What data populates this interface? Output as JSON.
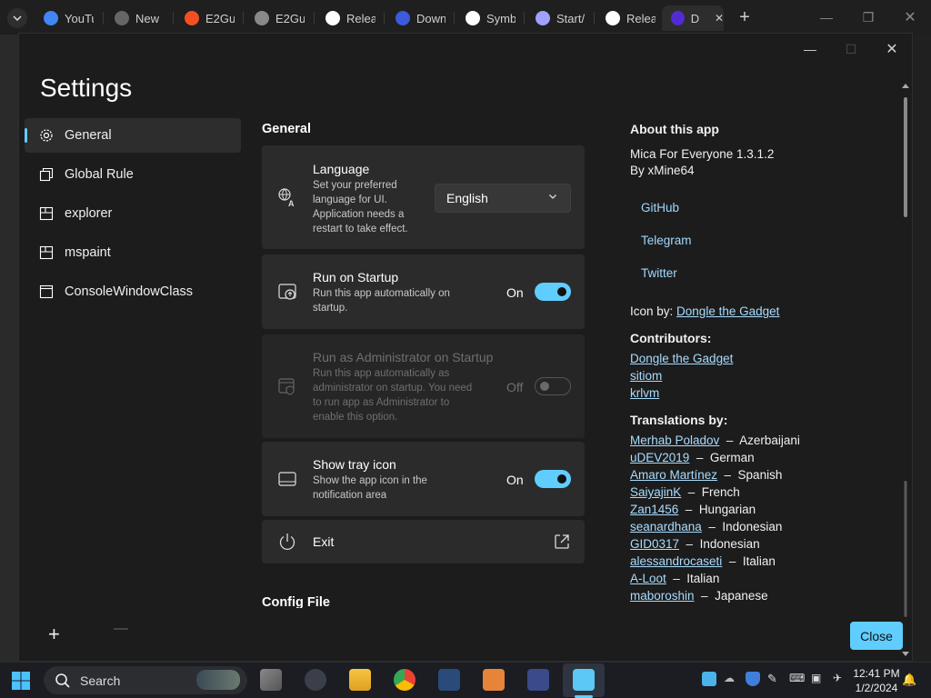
{
  "browser_tabs": [
    {
      "label": "YouTu",
      "icon": "google-icon",
      "color": "#4285f4"
    },
    {
      "label": "New",
      "icon": "chrome-icon",
      "color": "#666"
    },
    {
      "label": "E2Gu",
      "icon": "microsoft-icon",
      "color": "#f25022"
    },
    {
      "label": "E2Gu",
      "icon": "globe-icon",
      "color": "#888"
    },
    {
      "label": "Relea",
      "icon": "github-icon",
      "color": "#fff"
    },
    {
      "label": "Down",
      "icon": "v-icon",
      "color": "#3b5bdb"
    },
    {
      "label": "Symb",
      "icon": "github-icon",
      "color": "#fff"
    },
    {
      "label": "Start/",
      "icon": "doc-icon",
      "color": "#a0a0ff"
    },
    {
      "label": "Relea",
      "icon": "github-icon",
      "color": "#fff"
    },
    {
      "label": "D",
      "icon": "dotnet-icon",
      "color": "#512bd4"
    }
  ],
  "window": {
    "title": "Settings",
    "close_button": "Close"
  },
  "nav": [
    {
      "label": "General",
      "icon": "gear-icon",
      "selected": true
    },
    {
      "label": "Global Rule",
      "icon": "windows-stack-icon"
    },
    {
      "label": "explorer",
      "icon": "window-icon"
    },
    {
      "label": "mspaint",
      "icon": "window-icon"
    },
    {
      "label": "ConsoleWindowClass",
      "icon": "window-icon"
    }
  ],
  "general": {
    "section_title": "General",
    "language": {
      "title": "Language",
      "desc": [
        "Set your preferred",
        "language for UI.",
        "Application needs a",
        "restart to take effect."
      ],
      "value": "English"
    },
    "startup": {
      "title": "Run on Startup",
      "desc": [
        "Run this app automatically on",
        "startup."
      ],
      "state": "On"
    },
    "admin": {
      "title": "Run as Administrator on Startup",
      "desc": [
        "Run this app automatically as",
        "administrator on startup. You need",
        "to run app as Administrator to",
        "enable this option."
      ],
      "state": "Off"
    },
    "tray": {
      "title": "Show tray icon",
      "desc": [
        "Show the app icon in the",
        "notification area"
      ],
      "state": "On"
    },
    "exit": {
      "title": "Exit"
    },
    "config_title": "Config File"
  },
  "about": {
    "title": "About this app",
    "version": "Mica For Everyone 1.3.1.2",
    "author": "By xMine64",
    "links": [
      "GitHub",
      "Telegram",
      "Twitter"
    ],
    "icon_by_label": "Icon by:",
    "icon_by_name": "Dongle the Gadget",
    "contributors_title": "Contributors:",
    "contributors": [
      "Dongle the Gadget",
      "sitiom",
      "krlvm"
    ],
    "translations_title": "Translations by:",
    "translations": [
      {
        "name": "Merhab Poladov",
        "lang": "Azerbaijani"
      },
      {
        "name": "uDEV2019",
        "lang": "German"
      },
      {
        "name": "Amaro Martínez",
        "lang": "Spanish"
      },
      {
        "name": "SaiyajinK",
        "lang": "French"
      },
      {
        "name": "Zan1456",
        "lang": "Hungarian"
      },
      {
        "name": "seanardhana",
        "lang": "Indonesian"
      },
      {
        "name": "GID0317",
        "lang": "Indonesian"
      },
      {
        "name": "alessandrocaseti",
        "lang": "Italian"
      },
      {
        "name": "A-Loot",
        "lang": "Italian"
      },
      {
        "name": "maboroshin",
        "lang": "Japanese"
      }
    ]
  },
  "taskbar": {
    "search_placeholder": "Search",
    "time": "12:41 PM",
    "date": "1/2/2024"
  },
  "colors": {
    "accent": "#60cdff",
    "window_bg": "#1c1c1c",
    "card_bg": "#2b2b2b"
  }
}
